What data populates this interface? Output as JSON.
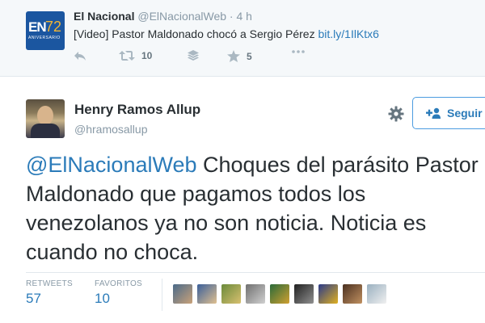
{
  "parent_tweet": {
    "avatar": {
      "icon": "el-nacional-logo-icon",
      "text": "EN",
      "number": "72",
      "sub": "ANIVERSARIO"
    },
    "name": "El Nacional",
    "handle": "@ElNacionalWeb",
    "separator": "·",
    "time": "4 h",
    "text": "[Video] Pastor Maldonado chocó a Sergio Pérez",
    "link": "bit.ly/1IlKtx6",
    "actions": {
      "reply": {
        "icon": "reply-icon"
      },
      "retweet": {
        "icon": "retweet-icon",
        "count": "10"
      },
      "buffer": {
        "icon": "layers-icon"
      },
      "favorite": {
        "icon": "star-icon",
        "count": "5"
      },
      "more": {
        "icon": "more-icon"
      }
    }
  },
  "tweet": {
    "name": "Henry Ramos Allup",
    "handle": "@hramosallup",
    "follow_label": "Seguir",
    "mention": "@ElNacionalWeb",
    "text": "Choques del parásito Pastor Maldonado que pagamos todos los venezolanos ya no son noticia. Noticia es cuando no choca.",
    "stats": {
      "retweets_label": "RETWEETS",
      "retweets_value": "57",
      "favorites_label": "FAVORITOS",
      "favorites_value": "10"
    },
    "favoriters_count": 9
  },
  "colors": {
    "link": "#2b7bb9",
    "muted": "#8899a6",
    "text": "#292f33",
    "parent_bg": "#f5f8fa",
    "brand_blue": "#1b56a0"
  }
}
